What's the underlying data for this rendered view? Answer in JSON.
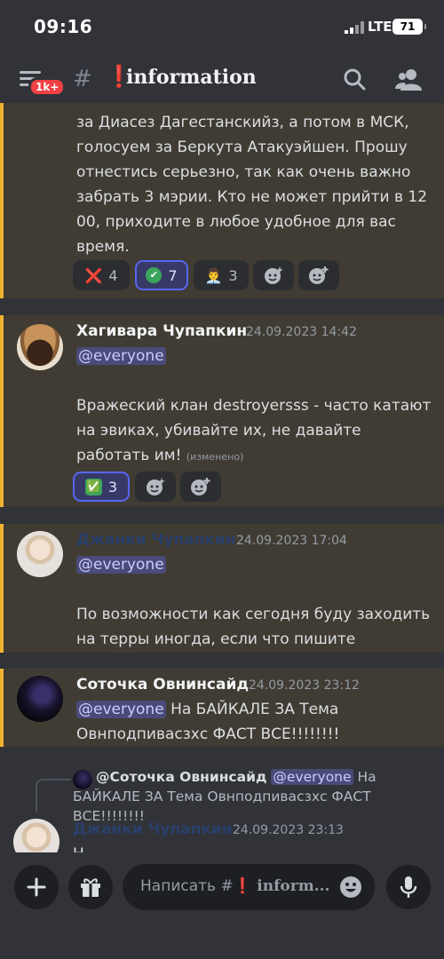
{
  "status_bar": {
    "time": "09:16",
    "network": "LTE",
    "battery": "71"
  },
  "header": {
    "unread_badge": "1k+",
    "hash": "#",
    "channel_emoji": "❗",
    "channel_name": "information"
  },
  "messages": [
    {
      "text": "за Диасез Дагестанскийз, а потом в МСК, голосуем за Беркута Атакуэйшен. Прошу отнестись серьезно, так как очень важно забрать 3 мэрии. Кто не может прийти в 12 00, приходите в любое удобное для вас время.",
      "reactions": [
        {
          "emoji": "❌",
          "count": "4"
        },
        {
          "emoji": "✔",
          "count": "7"
        },
        {
          "emoji": "👨‍💼",
          "count": "3"
        }
      ]
    },
    {
      "author": "Хагивара Чупапкин",
      "author_color": "#f2f3f5",
      "timestamp": "24.09.2023 14:42",
      "mention": "@everyone",
      "text": "Вражеский клан destroyersss - часто катают на эвиках, убивайте их, не давайте работать им!",
      "edited": "(изменено)",
      "reactions": [
        {
          "emoji": "✅",
          "count": "3"
        }
      ]
    },
    {
      "author": "Джанки Чупапкин",
      "author_color": "#2a3f6a",
      "timestamp": "24.09.2023 17:04",
      "mention": "@everyone",
      "text": "По возможности как сегодня буду заходить на терры иногда, если что пишите"
    },
    {
      "author": "Соточка Овнинсайд",
      "author_color": "#f2f3f5",
      "timestamp": "24.09.2023 23:12",
      "mention": "@everyone",
      "text": "На БАЙКАЛЕ ЗА Тема Овнподпивасзхс ФАСТ ВСЕ!!!!!!!!"
    },
    {
      "reply_author": "@Соточка Овнинсайд",
      "reply_mention": "@everyone",
      "reply_text": "На БАЙКАЛЕ ЗА Тема Овнподпивасзхс ФАСТ ВСЕ!!!!!!!!",
      "author": "Джанки Чупапкин",
      "author_color": "#2a3f6a",
      "timestamp": "24.09.2023 23:13",
      "text": "Н"
    }
  ],
  "composer": {
    "placeholder_prefix": "Написать #",
    "channel_emoji": "❗",
    "channel_name": "inform..."
  },
  "colors": {
    "background": "#313338",
    "highlight": "#403c33",
    "highlight_border": "#f0b232",
    "mention_bg": "#4a4b7a",
    "accent": "#5865f2"
  }
}
